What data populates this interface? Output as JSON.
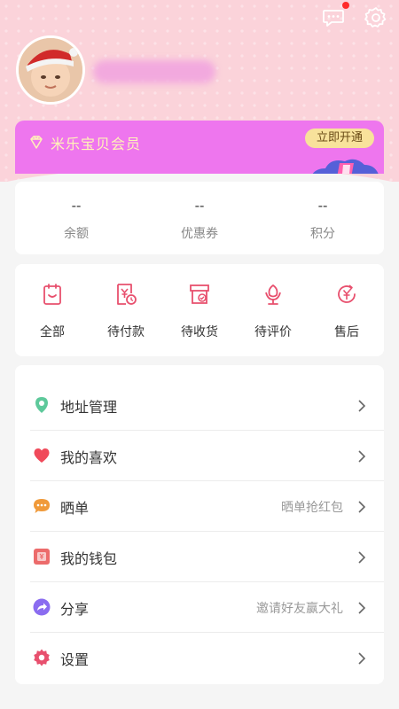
{
  "header": {
    "message_icon": "chat-bubble-icon",
    "settings_icon": "gear-icon",
    "has_unread": true
  },
  "member": {
    "title": "米乐宝贝会员",
    "button": "立即开通"
  },
  "stats": [
    {
      "value": "--",
      "label": "余额"
    },
    {
      "value": "--",
      "label": "优惠券"
    },
    {
      "value": "--",
      "label": "积分"
    }
  ],
  "orders": [
    {
      "label": "全部",
      "icon": "all-orders-icon"
    },
    {
      "label": "待付款",
      "icon": "pending-payment-icon"
    },
    {
      "label": "待收货",
      "icon": "pending-receipt-icon"
    },
    {
      "label": "待评价",
      "icon": "pending-review-icon"
    },
    {
      "label": "售后",
      "icon": "after-sales-icon"
    }
  ],
  "menu": [
    {
      "label": "地址管理",
      "hint": "",
      "icon": "location-pin-icon"
    },
    {
      "label": "我的喜欢",
      "hint": "",
      "icon": "heart-icon"
    },
    {
      "label": "晒单",
      "hint": "晒单抢红包",
      "icon": "comment-icon"
    },
    {
      "label": "我的钱包",
      "hint": "",
      "icon": "wallet-icon"
    },
    {
      "label": "分享",
      "hint": "邀请好友赢大礼",
      "icon": "share-icon"
    },
    {
      "label": "设置",
      "hint": "",
      "icon": "settings-icon"
    }
  ],
  "colors": {
    "header_bg": "#fbd3da",
    "member_card": "#ee76ee",
    "accent": "#e8506e",
    "button_gold": "#f8e29b"
  }
}
